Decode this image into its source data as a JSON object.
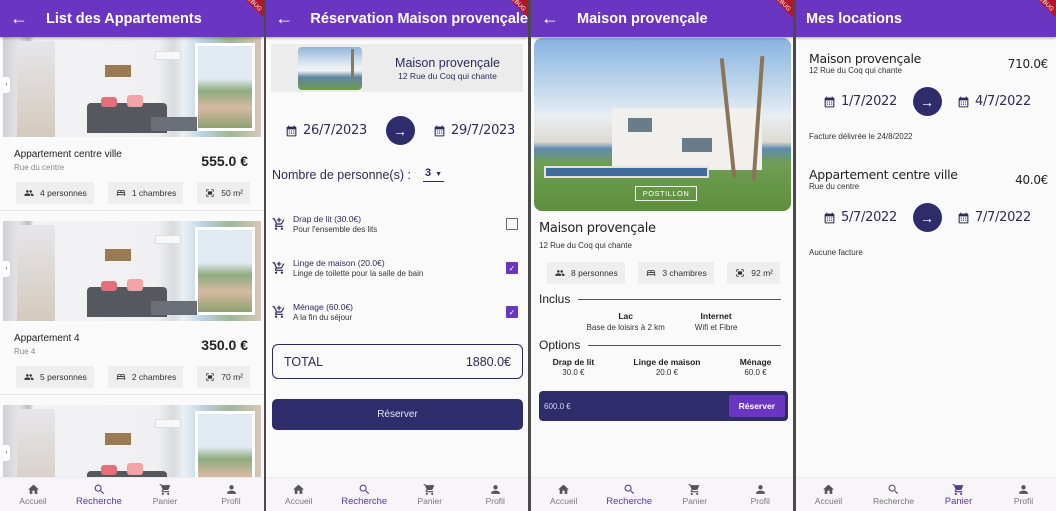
{
  "colors": {
    "primary": "#6a35c0",
    "dark_accent": "#2f2c6b",
    "text_accent": "#2d2a5c",
    "background": "#fafafa"
  },
  "debug_banner": "DEBUG",
  "bottom_nav": [
    {
      "label": "Accueil",
      "icon": "home-icon"
    },
    {
      "label": "Recherche",
      "icon": "search-icon"
    },
    {
      "label": "Panier",
      "icon": "cart-icon"
    },
    {
      "label": "Profil",
      "icon": "person-icon"
    }
  ],
  "screen_list": {
    "title": "List des Appartements",
    "active_nav": "Recherche",
    "apartments": [
      {
        "name": "Appartement centre ville",
        "street": "Rue du centre",
        "price": "555.0 €",
        "persons": "4 personnes",
        "rooms": "1 chambres",
        "area": "50 m²"
      },
      {
        "name": "Appartement 4",
        "street": "Rue 4",
        "price": "350.0 €",
        "persons": "5 personnes",
        "rooms": "2 chambres",
        "area": "70 m²"
      }
    ]
  },
  "screen_reservation": {
    "title": "Réservation Maison provençale",
    "active_nav": "Recherche",
    "property_name": "Maison provençale",
    "property_address": "12 Rue du Coq qui chante",
    "date_start": "26/7/2023",
    "date_end": "29/7/2023",
    "persons_label": "Nombre de personne(s) :",
    "persons_value": "3",
    "options": [
      {
        "title": "Drap de lit (30.0€)",
        "subtitle": "Pour l'ensemble des lits",
        "checked": false
      },
      {
        "title": "Linge de maison (20.0€)",
        "subtitle": "Linge de toilette pour la salle de bain",
        "checked": true
      },
      {
        "title": "Ménage (60.0€)",
        "subtitle": "A la fin du séjour",
        "checked": true
      }
    ],
    "total_label": "TOTAL",
    "total_value": "1880.0€",
    "reserve_label": "Réserver"
  },
  "screen_detail": {
    "title": "Maison provençale",
    "active_nav": "Recherche",
    "photo_watermark": "POSTILLON",
    "name": "Maison provençale",
    "address": "12 Rue du Coq qui chante",
    "persons": "8 personnes",
    "rooms": "3 chambres",
    "area": "92 m²",
    "included_title": "Inclus",
    "included": [
      {
        "title": "Lac",
        "subtitle": "Base de loisirs à 2 km"
      },
      {
        "title": "Internet",
        "subtitle": "Wifi et Fibre"
      }
    ],
    "options_title": "Options",
    "options": [
      {
        "title": "Drap de lit",
        "price": "30.0 €"
      },
      {
        "title": "Linge de maison",
        "price": "20.0 €"
      },
      {
        "title": "Ménage",
        "price": "60.0 €"
      }
    ],
    "book_price": "600.0 €",
    "book_label": "Réserver"
  },
  "screen_locations": {
    "title": "Mes locations",
    "active_nav": "Panier",
    "rentals": [
      {
        "name": "Maison provençale",
        "address": "12 Rue du Coq qui chante",
        "price": "710.0€",
        "date_start": "1/7/2022",
        "date_end": "4/7/2022",
        "invoice": "Facture délivrée le 24/8/2022"
      },
      {
        "name": "Appartement centre ville",
        "address": "Rue du centre",
        "price": "40.0€",
        "date_start": "5/7/2022",
        "date_end": "7/7/2022",
        "invoice": "Aucune facture"
      }
    ]
  }
}
